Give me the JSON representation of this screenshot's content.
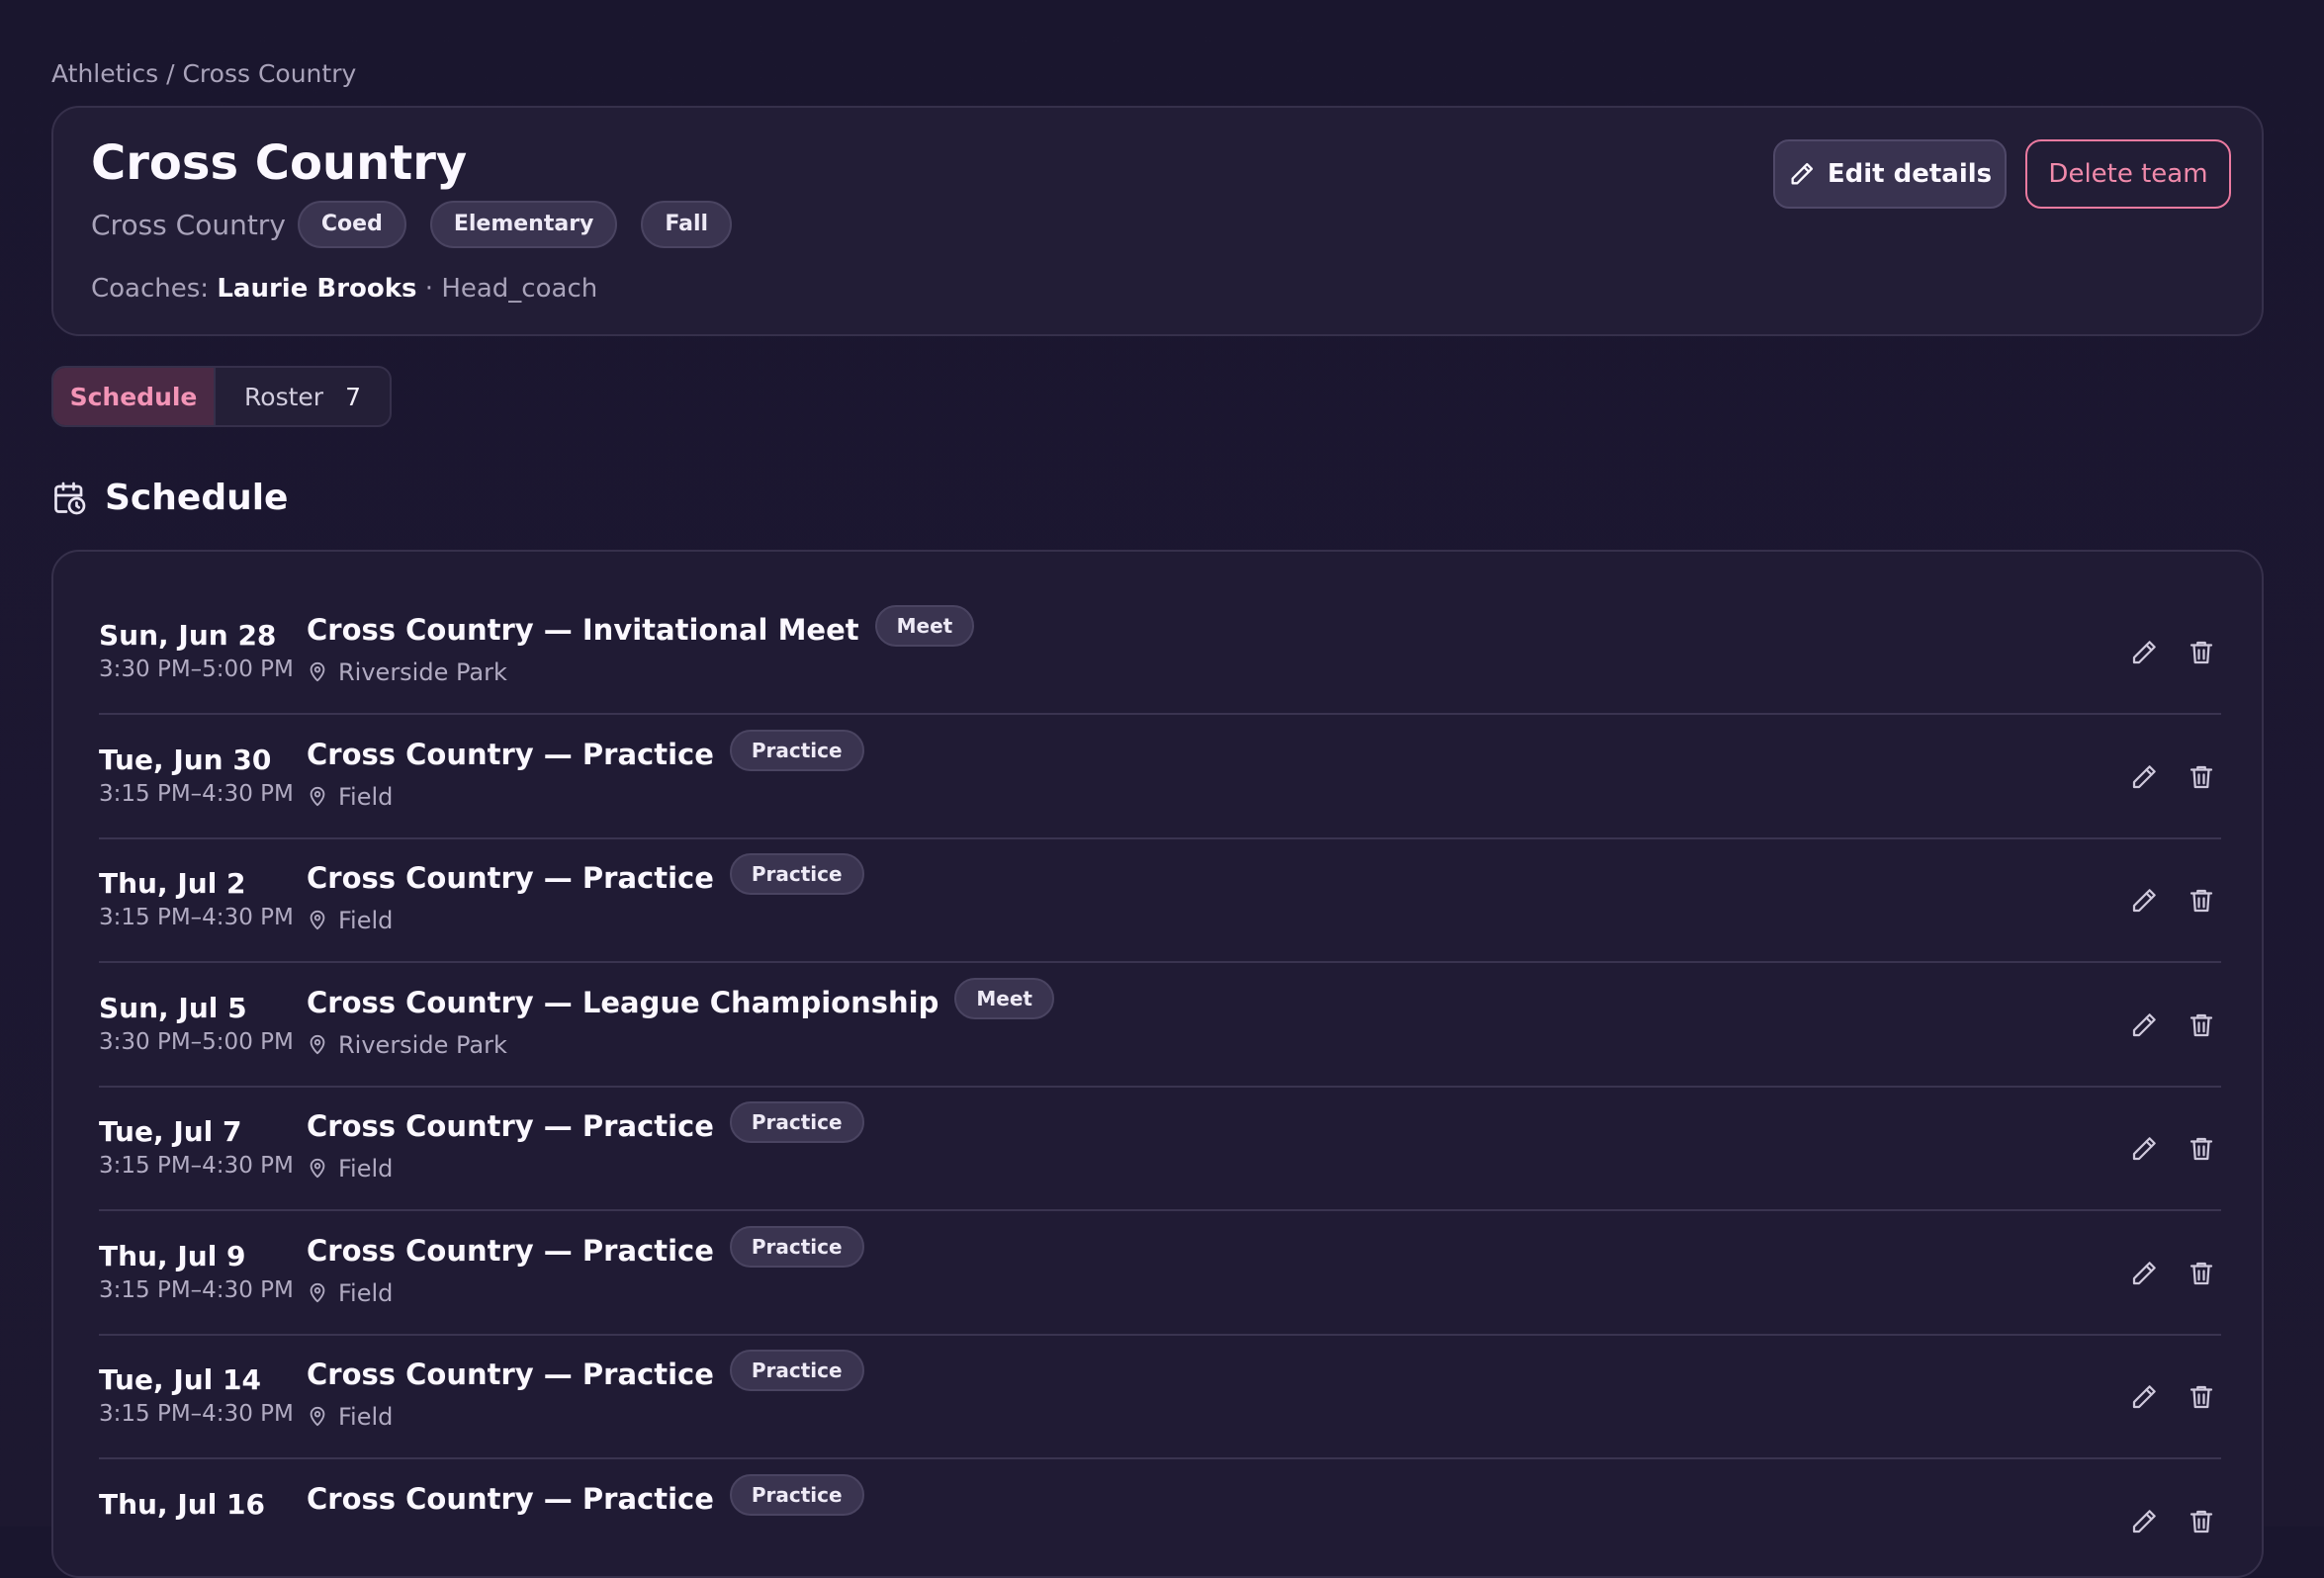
{
  "breadcrumb": "Athletics / Cross Country",
  "team": {
    "name": "Cross Country",
    "sport": "Cross Country",
    "tags": [
      "Coed",
      "Elementary",
      "Fall"
    ],
    "coaches_label": "Coaches:",
    "coach_name": "Laurie Brooks",
    "coach_role": "· Head_coach"
  },
  "actions": {
    "edit_label": "Edit details",
    "delete_label": "Delete team"
  },
  "tabs": {
    "schedule_label": "Schedule",
    "roster_label": "Roster",
    "roster_count": "7"
  },
  "schedule": {
    "title": "Schedule",
    "events": [
      {
        "date": "Sun, Jun 28",
        "time": "3:30 PM–5:00 PM",
        "title": "Cross Country — Invitational Meet",
        "type": "Meet",
        "location": "Riverside Park"
      },
      {
        "date": "Tue, Jun 30",
        "time": "3:15 PM–4:30 PM",
        "title": "Cross Country — Practice",
        "type": "Practice",
        "location": "Field"
      },
      {
        "date": "Thu, Jul 2",
        "time": "3:15 PM–4:30 PM",
        "title": "Cross Country — Practice",
        "type": "Practice",
        "location": "Field"
      },
      {
        "date": "Sun, Jul 5",
        "time": "3:30 PM–5:00 PM",
        "title": "Cross Country — League Championship",
        "type": "Meet",
        "location": "Riverside Park"
      },
      {
        "date": "Tue, Jul 7",
        "time": "3:15 PM–4:30 PM",
        "title": "Cross Country — Practice",
        "type": "Practice",
        "location": "Field"
      },
      {
        "date": "Thu, Jul 9",
        "time": "3:15 PM–4:30 PM",
        "title": "Cross Country — Practice",
        "type": "Practice",
        "location": "Field"
      },
      {
        "date": "Tue, Jul 14",
        "time": "3:15 PM–4:30 PM",
        "title": "Cross Country — Practice",
        "type": "Practice",
        "location": "Field"
      },
      {
        "date": "Thu, Jul 16",
        "time": "",
        "title": "Cross Country — Practice",
        "type": "Practice",
        "location": ""
      }
    ]
  },
  "colors": {
    "background": "#1b1630",
    "card": "#221d36",
    "accent_pink": "#f08aab",
    "active_tab_bg": "#4a2a45"
  },
  "icons": [
    "pencil-icon",
    "calendar-clock-icon",
    "map-pin-icon",
    "trash-icon"
  ]
}
